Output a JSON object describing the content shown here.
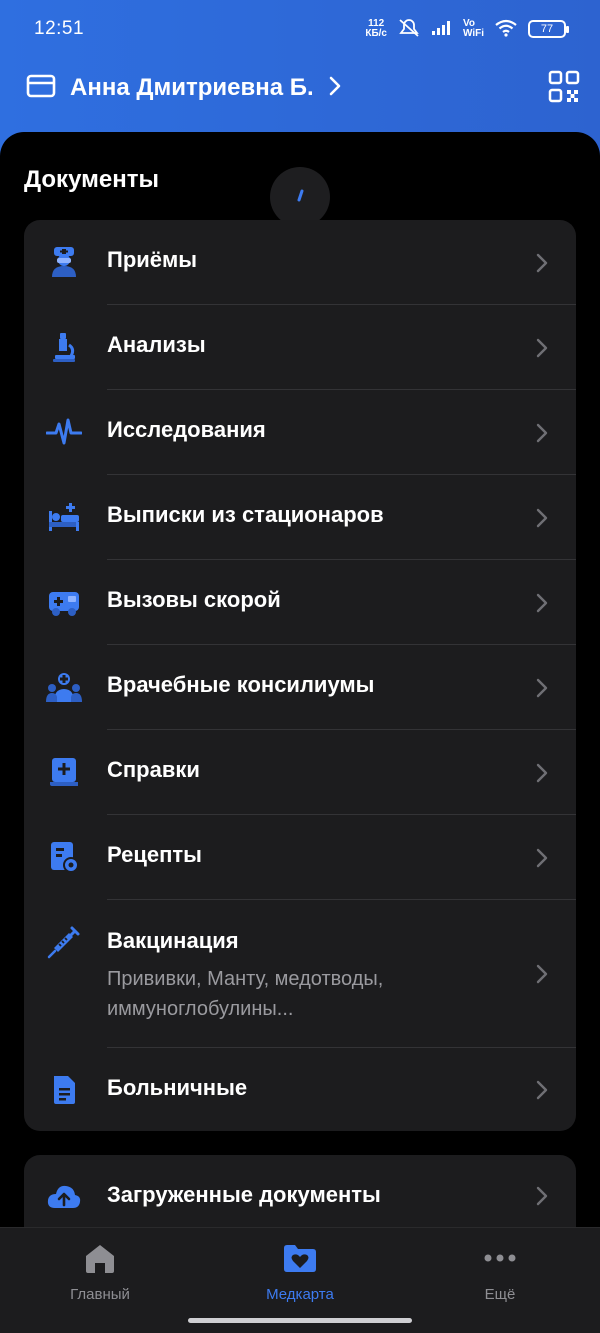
{
  "status": {
    "time": "12:51",
    "net_speed_value": "112",
    "net_speed_unit": "КБ/с",
    "vo": "Vo",
    "wifi_label": "WiFi",
    "battery": "77"
  },
  "header": {
    "profile_name": "Анна Дмитриевна Б."
  },
  "documents": {
    "title": "Документы",
    "items": [
      {
        "label": "Приёмы",
        "icon": "doctor-icon"
      },
      {
        "label": "Анализы",
        "icon": "microscope-icon"
      },
      {
        "label": "Исследования",
        "icon": "pulse-icon"
      },
      {
        "label": "Выписки из стационаров",
        "icon": "hospital-bed-icon"
      },
      {
        "label": "Вызовы скорой",
        "icon": "ambulance-icon"
      },
      {
        "label": "Врачебные консилиумы",
        "icon": "doctors-group-icon"
      },
      {
        "label": "Справки",
        "icon": "certificate-icon"
      },
      {
        "label": "Рецепты",
        "icon": "prescription-icon"
      },
      {
        "label": "Вакцинация",
        "icon": "syringe-icon",
        "subtitle": "Прививки, Манту, медотводы, иммуноглобулины..."
      },
      {
        "label": "Больничные",
        "icon": "sick-leave-doc-icon"
      }
    ]
  },
  "uploaded": {
    "label": "Загруженные документы",
    "icon": "cloud-upload-icon"
  },
  "tabs": [
    {
      "label": "Главный",
      "icon": "home-icon",
      "active": false
    },
    {
      "label": "Медкарта",
      "icon": "medcard-heart-icon",
      "active": true
    },
    {
      "label": "Ещё",
      "icon": "more-dots-icon",
      "active": false
    }
  ],
  "colors": {
    "accent": "#3d7bf0",
    "header": "#2f6fe0",
    "card": "#1c1c1e"
  }
}
